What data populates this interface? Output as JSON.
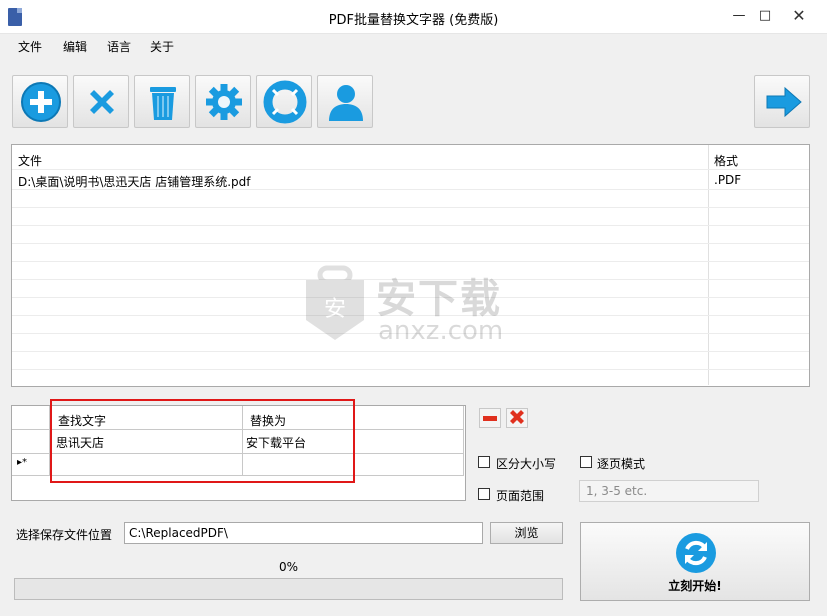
{
  "window": {
    "title": "PDF批量替换文字器 (免费版)",
    "minimize": "—",
    "maximize": "□",
    "close": "✕"
  },
  "menu": [
    "文件",
    "编辑",
    "语言",
    "关于"
  ],
  "toolbar": {
    "buttons": [
      "add-icon",
      "remove-icon",
      "trash-icon",
      "gear-icon",
      "lifebuoy-icon",
      "user-icon"
    ],
    "next": "arrow-right-icon"
  },
  "file_list": {
    "columns": [
      "文件",
      "格式"
    ],
    "rows": [
      {
        "file": "D:\\桌面\\说明书\\思迅天店 店铺管理系统.pdf",
        "format": ".PDF"
      }
    ]
  },
  "watermark": {
    "text": "安下载",
    "url": "anxz.com"
  },
  "replace_table": {
    "columns": [
      "查找文字",
      "替换为"
    ],
    "rows": [
      {
        "find": "思讯天店",
        "replace": "安下载平台"
      }
    ],
    "new_row_marker": "▸*"
  },
  "options": {
    "case_sensitive": "区分大小写",
    "page_mode": "逐页模式",
    "page_range": "页面范围",
    "page_range_placeholder": "1, 3-5 etc."
  },
  "save": {
    "label": "选择保存文件位置",
    "path": "C:\\ReplacedPDF\\",
    "browse": "浏览"
  },
  "progress": {
    "text": "0%",
    "value": 0
  },
  "start": {
    "label": "立刻开始!"
  },
  "colors": {
    "accent_blue": "#1a9be0",
    "delete_red": "#e0301e",
    "highlight_red": "#e01818"
  }
}
